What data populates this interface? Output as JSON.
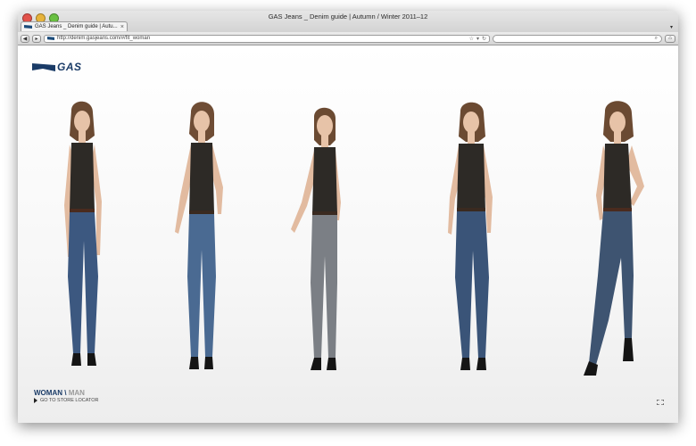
{
  "window": {
    "title": "GAS Jeans _ Denim guide | Autumn / Winter 2011–12"
  },
  "tab": {
    "label": "GAS Jeans _ Denim guide | Autu..."
  },
  "address": {
    "url": "http://denim.gasjeans.com/#/fit_woman"
  },
  "search": {
    "placeholder": ""
  },
  "brand": {
    "logo_text": "GAS",
    "color": "#1a3b67"
  },
  "nav": {
    "woman": "WOMAN",
    "separator": "\\",
    "man": "MAN",
    "store_locator": "GO TO STORE LOCATOR"
  },
  "models": [
    {
      "name": "model-1",
      "jeans": "#3c5880"
    },
    {
      "name": "model-2",
      "jeans": "#4a6a92"
    },
    {
      "name": "model-3",
      "jeans": "#7b7f85"
    },
    {
      "name": "model-4",
      "jeans": "#3a5478"
    },
    {
      "name": "model-5",
      "jeans": "#3e5471"
    }
  ],
  "icons": [
    "back-icon",
    "forward-icon",
    "bookmark-star-icon",
    "dropdown-icon",
    "reload-icon",
    "search-icon",
    "home-icon",
    "fullscreen-icon"
  ]
}
